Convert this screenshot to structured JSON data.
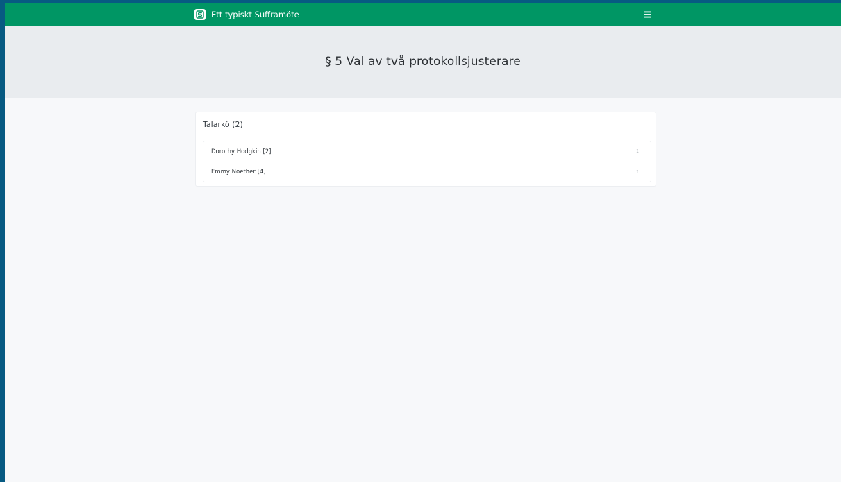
{
  "navbar": {
    "brand_title": "Ett typiskt Sufframöte",
    "brand_icon": "suffra-logo-icon",
    "menu_icon": "hamburger-menu-icon",
    "color": "#009664"
  },
  "header": {
    "title": "§ 5 Val av två protokollsjusterare"
  },
  "speaker_list": {
    "title": "Talarkö (2)",
    "items": [
      {
        "name": "Dorothy Hodgkin [2]",
        "count": "1"
      },
      {
        "name": "Emmy Noether [4]",
        "count": "1"
      }
    ]
  }
}
